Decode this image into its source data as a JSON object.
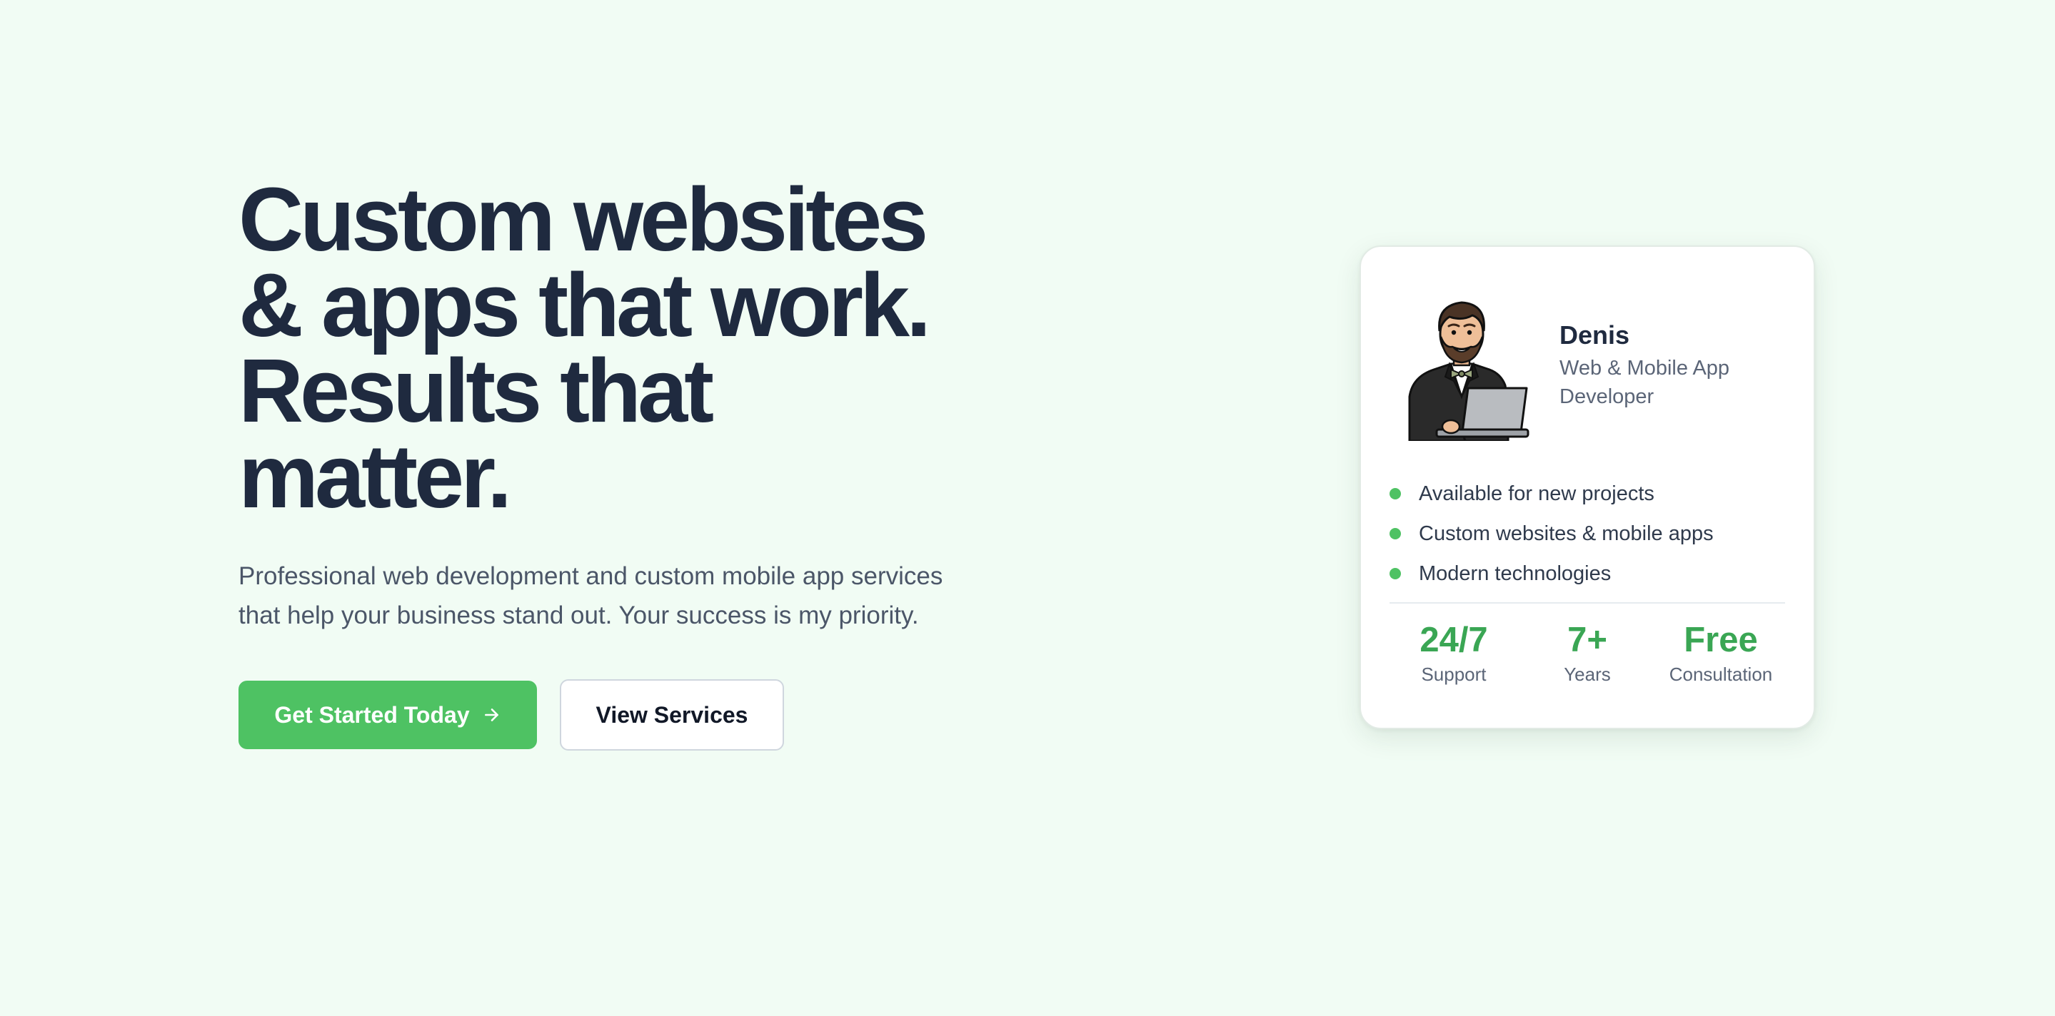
{
  "hero": {
    "headline_lines": [
      "Custom websites",
      "& apps that work.",
      "Results that",
      "matter."
    ],
    "subtitle_lines": [
      "Professional web development and custom mobile app services",
      "that help your business stand out. Your success is my priority."
    ],
    "primary_button": {
      "label": "Get Started Today",
      "icon": "arrow-right-icon"
    },
    "secondary_button": {
      "label": "View Services"
    }
  },
  "card": {
    "avatar_icon": "developer-avatar-illustration",
    "name": "Denis",
    "role": "Web & Mobile App Developer",
    "features": [
      "Available for new projects",
      "Custom websites & mobile apps",
      "Modern technologies"
    ],
    "stats": [
      {
        "value": "24/7",
        "label": "Support"
      },
      {
        "value": "7+",
        "label": "Years"
      },
      {
        "value": "Free",
        "label": "Consultation"
      }
    ]
  },
  "colors": {
    "background": "#f1fcf4",
    "accent": "#4ec263",
    "accent_text": "#3aa654",
    "heading": "#1f2a3f",
    "body_text": "#4b5668"
  }
}
